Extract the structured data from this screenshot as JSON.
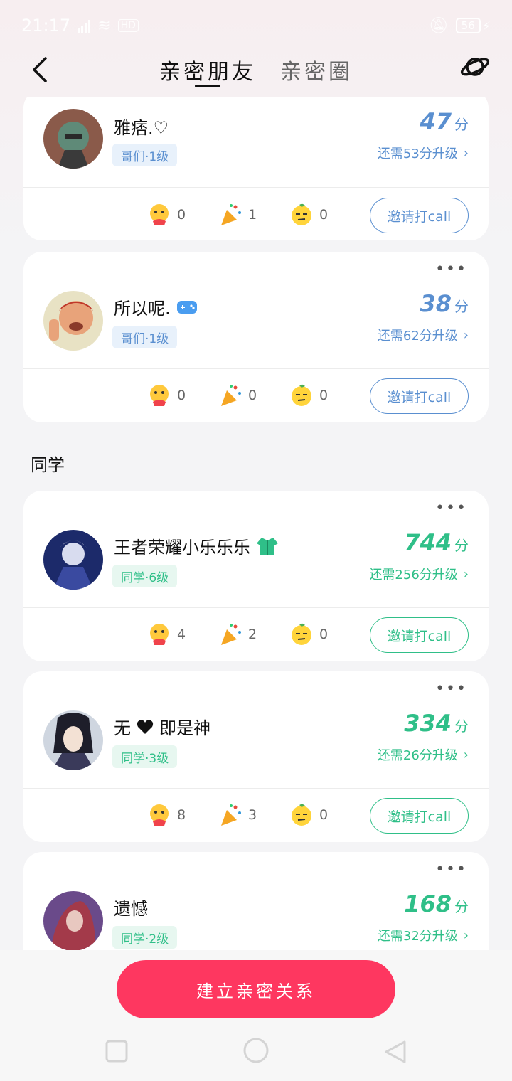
{
  "status_bar": {
    "time": "21:17",
    "network": "HD",
    "battery": "56"
  },
  "nav": {
    "tabs": [
      {
        "label": "亲密朋友",
        "active": true
      },
      {
        "label": "亲密圈",
        "active": false
      }
    ],
    "back_icon": "chevron-left-icon",
    "right_icon": "planet-icon"
  },
  "cards": [
    {
      "name": "雅痞.♡",
      "badge": "哥们·1级",
      "score": "47",
      "score_unit": "分",
      "upgrade": "还需53分升级",
      "stats": [
        "0",
        "1",
        "0"
      ],
      "invite": "邀请打call",
      "accent": "#5a8fd0"
    },
    {
      "name": "所以呢.",
      "badge": "哥们·1级",
      "score": "38",
      "score_unit": "分",
      "upgrade": "还需62分升级",
      "stats": [
        "0",
        "0",
        "0"
      ],
      "invite": "邀请打call",
      "accent": "#5a8fd0"
    },
    {
      "name": "王者荣耀小乐乐乐",
      "badge": "同学·6级",
      "score": "744",
      "score_unit": "分",
      "upgrade": "还需256分升级",
      "stats": [
        "4",
        "2",
        "0"
      ],
      "invite": "邀请打call",
      "accent": "#2fbf88"
    },
    {
      "name": "无",
      "name_suffix": "即是神",
      "badge": "同学·3级",
      "score": "334",
      "score_unit": "分",
      "upgrade": "还需26分升级",
      "stats": [
        "8",
        "3",
        "0"
      ],
      "invite": "邀请打call",
      "accent": "#2fbf88"
    },
    {
      "name": "遗憾",
      "badge": "同学·2级",
      "score": "168",
      "score_unit": "分",
      "upgrade": "还需32分升级",
      "accent": "#2fbf88"
    }
  ],
  "section": {
    "classmates": "同学"
  },
  "bottom": {
    "primary_button": "建立亲密关系"
  },
  "stat_icons": [
    "hug-face-icon",
    "party-popper-icon",
    "smirk-lemon-icon"
  ]
}
